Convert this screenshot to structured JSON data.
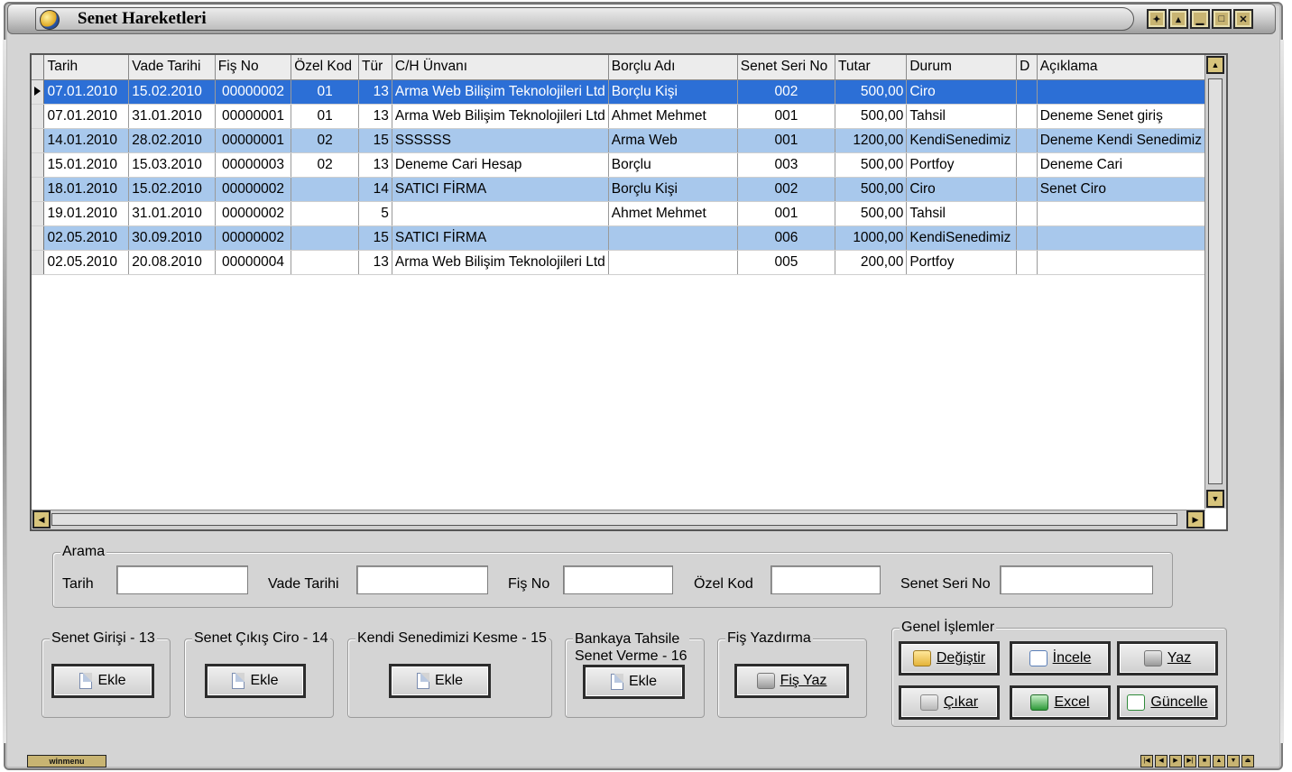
{
  "window": {
    "title": "Senet Hareketleri"
  },
  "columns": [
    "Tarih",
    "Vade Tarihi",
    "Fiş No",
    "Özel Kod",
    "Tür",
    "C/H Ünvanı",
    "Borçlu Adı",
    "Senet Seri No",
    "Tutar",
    "Durum",
    "D",
    "Açıklama"
  ],
  "rows": [
    {
      "tarih": "07.01.2010",
      "vade": "15.02.2010",
      "fis": "00000002",
      "ozel": "01",
      "tur": "13",
      "unvan": "Arma Web Bilişim Teknolojileri Ltd",
      "borclu": "Borçlu Kişi",
      "seri": "002",
      "tutar": "500,00",
      "durum": "Ciro",
      "d": "",
      "aciklama": ""
    },
    {
      "tarih": "07.01.2010",
      "vade": "31.01.2010",
      "fis": "00000001",
      "ozel": "01",
      "tur": "13",
      "unvan": "Arma Web Bilişim Teknolojileri Ltd",
      "borclu": "Ahmet Mehmet",
      "seri": "001",
      "tutar": "500,00",
      "durum": "Tahsil",
      "d": "",
      "aciklama": "Deneme Senet giriş"
    },
    {
      "tarih": "14.01.2010",
      "vade": "28.02.2010",
      "fis": "00000001",
      "ozel": "02",
      "tur": "15",
      "unvan": "SSSSSS",
      "borclu": "Arma Web",
      "seri": "001",
      "tutar": "1200,00",
      "durum": "KendiSenedimiz",
      "d": "",
      "aciklama": "Deneme Kendi Senedimiz"
    },
    {
      "tarih": "15.01.2010",
      "vade": "15.03.2010",
      "fis": "00000003",
      "ozel": "02",
      "tur": "13",
      "unvan": "Deneme Cari Hesap",
      "borclu": "Borçlu",
      "seri": "003",
      "tutar": "500,00",
      "durum": "Portfoy",
      "d": "",
      "aciklama": "Deneme Cari"
    },
    {
      "tarih": "18.01.2010",
      "vade": "15.02.2010",
      "fis": "00000002",
      "ozel": "",
      "tur": "14",
      "unvan": "SATICI FİRMA",
      "borclu": "Borçlu Kişi",
      "seri": "002",
      "tutar": "500,00",
      "durum": "Ciro",
      "d": "",
      "aciklama": "Senet Ciro"
    },
    {
      "tarih": "19.01.2010",
      "vade": "31.01.2010",
      "fis": "00000002",
      "ozel": "",
      "tur": "5",
      "unvan": "",
      "borclu": "Ahmet Mehmet",
      "seri": "001",
      "tutar": "500,00",
      "durum": "Tahsil",
      "d": "",
      "aciklama": ""
    },
    {
      "tarih": "02.05.2010",
      "vade": "30.09.2010",
      "fis": "00000002",
      "ozel": "",
      "tur": "15",
      "unvan": "SATICI FİRMA",
      "borclu": "",
      "seri": "006",
      "tutar": "1000,00",
      "durum": "KendiSenedimiz",
      "d": "",
      "aciklama": ""
    },
    {
      "tarih": "02.05.2010",
      "vade": "20.08.2010",
      "fis": "00000004",
      "ozel": "",
      "tur": "13",
      "unvan": "Arma Web Bilişim Teknolojileri Ltd",
      "borclu": "",
      "seri": "005",
      "tutar": "200,00",
      "durum": "Portfoy",
      "d": "",
      "aciklama": ""
    }
  ],
  "search": {
    "legend": "Arama",
    "tarih_label": "Tarih",
    "vade_label": "Vade Tarihi",
    "fis_label": "Fiş No",
    "ozel_label": "Özel Kod",
    "seri_label": "Senet Seri No",
    "tarih_value": "",
    "vade_value": "",
    "fis_value": "",
    "ozel_value": "",
    "seri_value": ""
  },
  "groups": {
    "giris": {
      "legend": "Senet Girişi - 13",
      "button": "Ekle"
    },
    "cikis": {
      "legend": "Senet Çıkış Ciro - 14",
      "button": "Ekle"
    },
    "kendi": {
      "legend": "Kendi Senedimizi Kesme - 15",
      "button": "Ekle"
    },
    "banka": {
      "legend_line1": "Bankaya Tahsile",
      "legend_line2": "Senet Verme - 16",
      "button": "Ekle"
    },
    "fis": {
      "legend": "Fiş Yazdırma",
      "button": "Fiş Yaz"
    },
    "genel": {
      "legend": "Genel İşlemler",
      "degistir": "Değiştir",
      "incele": "İncele",
      "yaz": "Yaz",
      "cikar": "Çıkar",
      "excel": "Excel",
      "guncelle": "Güncelle"
    }
  },
  "footer": {
    "logo": "winmenu"
  },
  "colors": {
    "selected_row": "#2c6fd6",
    "alt_row": "#a8c8ec",
    "frame": "#d4d4d4"
  }
}
